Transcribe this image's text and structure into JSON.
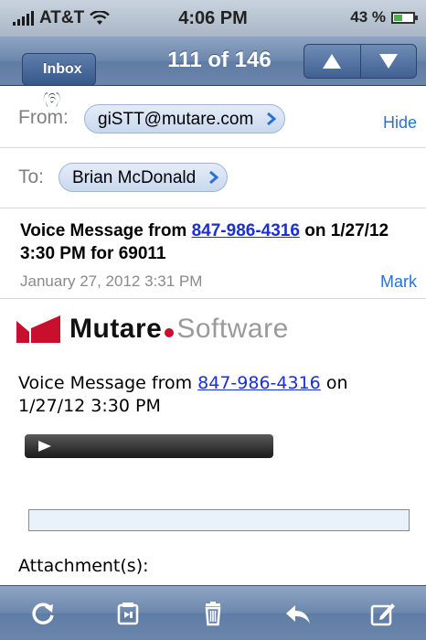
{
  "status_bar": {
    "carrier": "AT&T",
    "time": "4:06 PM",
    "battery": "43 %",
    "battery_level_percent": 43,
    "icons": [
      "signal-bars-icon",
      "wifi-icon",
      "battery-icon"
    ]
  },
  "nav": {
    "back_label": "Inbox (6)",
    "title": "111 of 146",
    "icons": [
      "up-arrow-icon",
      "down-arrow-icon"
    ]
  },
  "header": {
    "from_label": "From:",
    "from_value": "giSTT@mutare.com",
    "hide_label": "Hide",
    "to_label": "To:",
    "to_value": "Brian McDonald"
  },
  "subject": {
    "prefix": "Voice Message from ",
    "phone": "847-986-4316",
    "suffix": " on 1/27/12 3:30 PM for 69011"
  },
  "date": "January 27, 2012 3:31 PM",
  "mark_label": "Mark",
  "logo": {
    "text_bold": "Mutare",
    "text_light": "Software",
    "brand_color": "#c8102e"
  },
  "body": {
    "prefix": "Voice Message from ",
    "phone": "847-986-4316",
    "suffix": " on 1/27/12 3:30 PM"
  },
  "attachments_label": "Attachment(s):",
  "toolbar": {
    "icons": [
      "refresh-icon",
      "move-to-folder-icon",
      "trash-icon",
      "reply-icon",
      "compose-icon"
    ]
  },
  "colors": {
    "link": "#2a72d6",
    "phone_link": "#1b2fd8",
    "bar_blue": "#6c87ad"
  }
}
